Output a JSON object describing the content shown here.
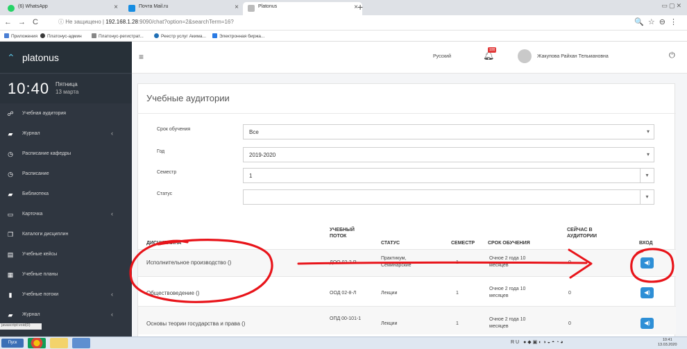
{
  "browser": {
    "tabs": [
      {
        "label": "(6) WhatsApp",
        "color": "#25d366",
        "active": false
      },
      {
        "label": "Почта Mail.ru",
        "color": "#168de2",
        "active": false
      },
      {
        "label": "Platonus",
        "color": "#999999",
        "active": true
      }
    ],
    "new_tab": "+",
    "address": {
      "security": "Не защищено",
      "host": "192.168.1.28",
      "path": ":9090/chat?option=2&searchTerm=16?"
    },
    "bookmarks": [
      {
        "label": "Приложения",
        "color": "#4a7fd4"
      },
      {
        "label": "Платонус-админ",
        "color": "#3a3a3a"
      },
      {
        "label": "Платонус-регистрат...",
        "color": "#888888"
      },
      {
        "label": "Реестр услуг Акима...",
        "color": "#1f6fb5"
      },
      {
        "label": "Электронная биржа...",
        "color": "#2a7be4"
      }
    ]
  },
  "sidebar": {
    "brand": "platonus",
    "time": "10:40",
    "weekday": "Пятница",
    "date": "13 марта",
    "items": [
      {
        "label": "Учебная аудитория",
        "icon": "group-icon",
        "glyph": "☍",
        "arrow": false
      },
      {
        "label": "Журнал",
        "icon": "book-icon",
        "glyph": "▰",
        "arrow": true
      },
      {
        "label": "Расписание кафедры",
        "icon": "clock-icon",
        "glyph": "◷",
        "arrow": false
      },
      {
        "label": "Расписание",
        "icon": "clock-icon",
        "glyph": "◷",
        "arrow": false
      },
      {
        "label": "Библиотека",
        "icon": "book-icon",
        "glyph": "▰",
        "arrow": false
      },
      {
        "label": "Карточка",
        "icon": "folder-icon",
        "glyph": "▭",
        "arrow": true
      },
      {
        "label": "Каталоги дисциплин",
        "icon": "catalog-icon",
        "glyph": "❐",
        "arrow": false
      },
      {
        "label": "Учебные кейсы",
        "icon": "list-icon",
        "glyph": "▤",
        "arrow": false
      },
      {
        "label": "Учебные планы",
        "icon": "grid-icon",
        "glyph": "▦",
        "arrow": false
      },
      {
        "label": "Учебные потоки",
        "icon": "file-icon",
        "glyph": "▮",
        "arrow": true
      },
      {
        "label": "Журнал",
        "icon": "book-icon",
        "glyph": "▰",
        "arrow": true
      }
    ],
    "status_text": "javascript:void(0)"
  },
  "header": {
    "language": "Русский",
    "notifications": "100",
    "user_name": "Жакупова Райхан Тельмановна"
  },
  "page": {
    "title": "Учебные аудитории",
    "filters": [
      {
        "label": "Срок обучения",
        "value": "Все"
      },
      {
        "label": "Год",
        "value": "2019-2020"
      },
      {
        "label": "Семестр",
        "value": "1"
      },
      {
        "label": "Статус",
        "value": ""
      }
    ],
    "table": {
      "headers": {
        "discipline": "ДИСЦИПЛИНА",
        "stream": "УЧЕБНЫЙ ПОТОК",
        "status": "СТАТУС",
        "semester": "СЕМЕСТР",
        "duration": "СРОК ОБУЧЕНИЯ",
        "now": "СЕЙЧАС В АУДИТОРИИ",
        "enter": "ВХОД"
      },
      "rows": [
        {
          "discipline": "Исполнительное производство ()",
          "stream": "ДОО 02-2-Р",
          "status": "Практикум, Семинарские",
          "semester": "1",
          "duration": "Очное 2 года 10 месяцев",
          "now": "0"
        },
        {
          "discipline": "Обществоведение ()",
          "stream": "ООД 02-8-Л",
          "status": "Лекции",
          "semester": "1",
          "duration": "Очное 2 года 10 месяцев",
          "now": "0"
        },
        {
          "discipline": "Основы теории государства и права ()",
          "stream": "ОПД 00-101-1",
          "status": "Лекции",
          "semester": "1",
          "duration": "Очное 2 года 10 месяцев",
          "now": "0"
        }
      ]
    }
  },
  "taskbar": {
    "start": "Пуск",
    "lang": "RU",
    "time": "10:41",
    "date": "13.03.2020"
  }
}
